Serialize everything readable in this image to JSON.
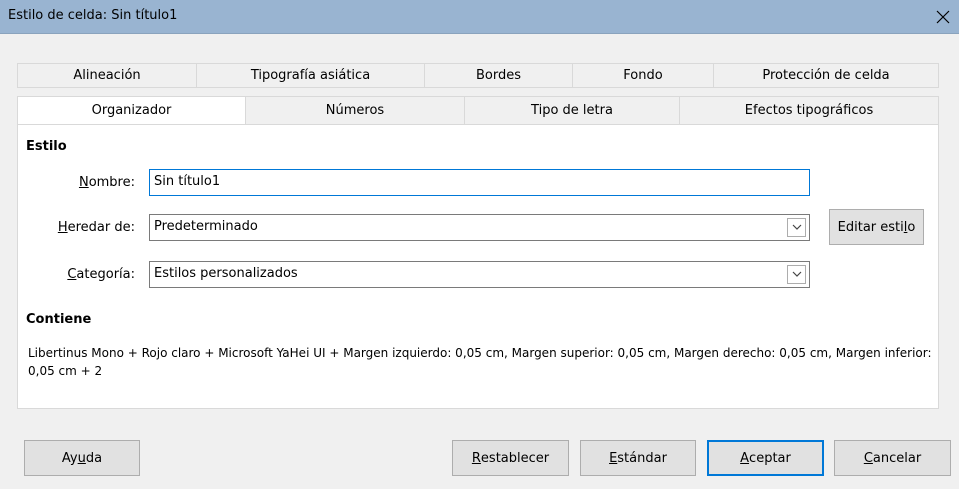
{
  "window": {
    "title": "Estilo de celda: Sin título1",
    "close_icon": "close-icon"
  },
  "tabs_row1": [
    {
      "label": "Alineación"
    },
    {
      "label": "Tipografía asiática"
    },
    {
      "label": "Bordes"
    },
    {
      "label": "Fondo"
    },
    {
      "label": "Protección de celda"
    }
  ],
  "tabs_row2": [
    {
      "label": "Organizador",
      "active": true
    },
    {
      "label": "Números"
    },
    {
      "label": "Tipo de letra"
    },
    {
      "label": "Efectos tipográficos"
    }
  ],
  "estilo": {
    "heading": "Estilo",
    "nombre_label_pre": "",
    "nombre_label_u": "N",
    "nombre_label_post": "ombre:",
    "nombre_value": "Sin título1",
    "heredar_label_u": "H",
    "heredar_label_post": "eredar de:",
    "heredar_value": "Predeterminado",
    "categoria_label_u": "C",
    "categoria_label_post": "ategoría:",
    "categoria_value": "Estilos personalizados",
    "editar_pre": "Editar esti",
    "editar_u": "l",
    "editar_post": "o"
  },
  "contiene": {
    "heading": "Contiene",
    "text": "Libertinus Mono + Rojo claro + Microsoft YaHei UI + Margen izquierdo: 0,05 cm, Margen superior: 0,05 cm, Margen derecho: 0,05 cm, Margen inferior: 0,05 cm + 2"
  },
  "buttons": {
    "ayuda_pre": "Ay",
    "ayuda_u": "u",
    "ayuda_post": "da",
    "restablecer_u": "R",
    "restablecer_post": "establecer",
    "estandar_u": "E",
    "estandar_post": "stándar",
    "aceptar_u": "A",
    "aceptar_post": "ceptar",
    "cancelar_u": "C",
    "cancelar_post": "ancelar"
  }
}
